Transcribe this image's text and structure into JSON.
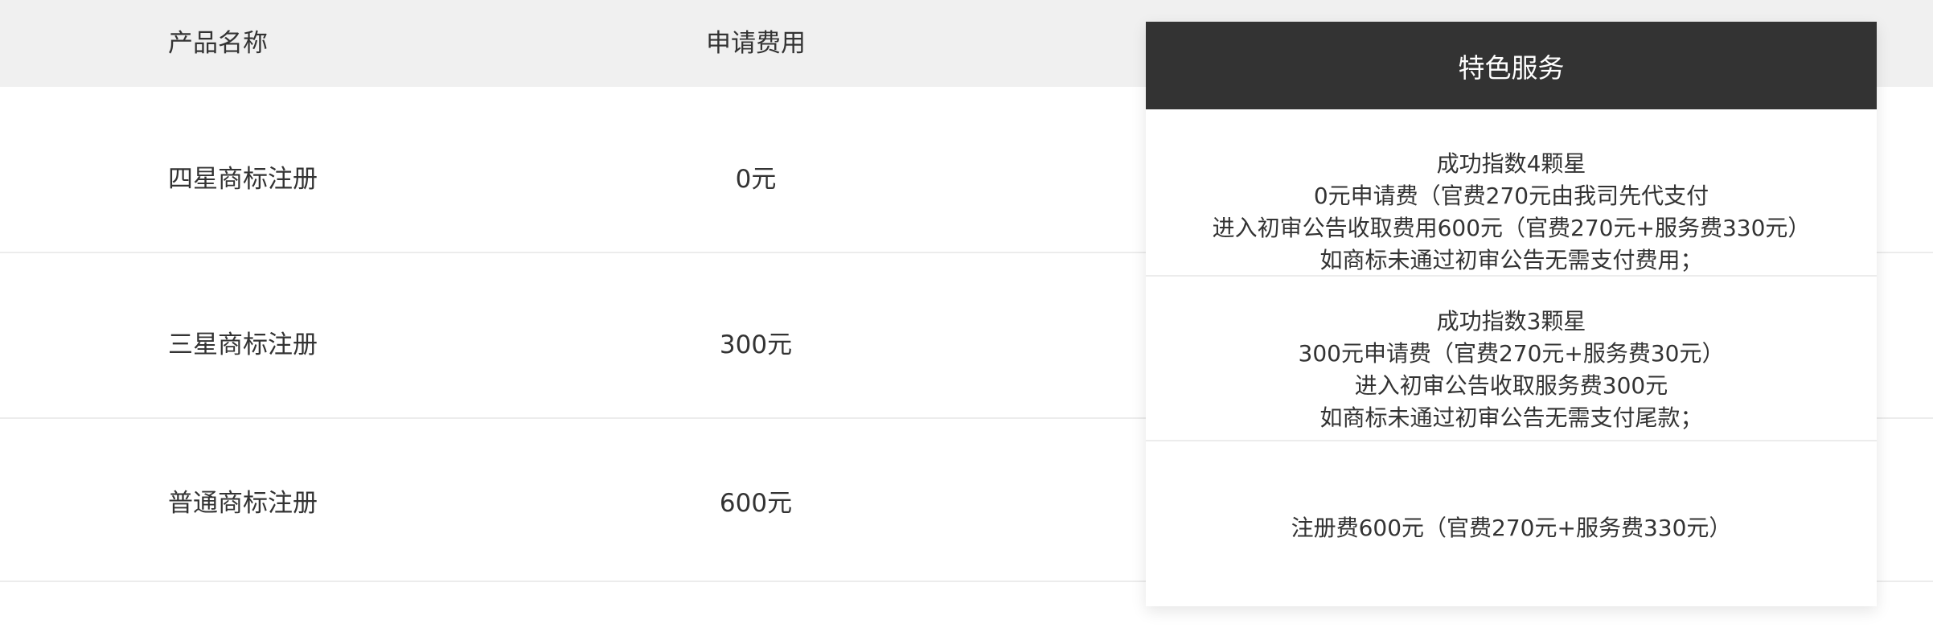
{
  "table": {
    "headers": {
      "product": "产品名称",
      "fee": "申请费用"
    },
    "rows": [
      {
        "product": "四星商标注册",
        "fee": "0元"
      },
      {
        "product": "三星商标注册",
        "fee": "300元"
      },
      {
        "product": "普通商标注册",
        "fee": "600元"
      }
    ]
  },
  "panel": {
    "title": "特色服务",
    "services": [
      {
        "lines": [
          "成功指数4颗星",
          "0元申请费（官费270元由我司先代支付",
          "进入初审公告收取费用600元（官费270元+服务费330元）",
          "如商标未通过初审公告无需支付费用；"
        ]
      },
      {
        "lines": [
          "成功指数3颗星",
          "300元申请费（官费270元+服务费30元）",
          "进入初审公告收取服务费300元",
          "如商标未通过初审公告无需支付尾款；"
        ]
      },
      {
        "lines": [
          "注册费600元（官费270元+服务费330元）"
        ]
      }
    ]
  }
}
